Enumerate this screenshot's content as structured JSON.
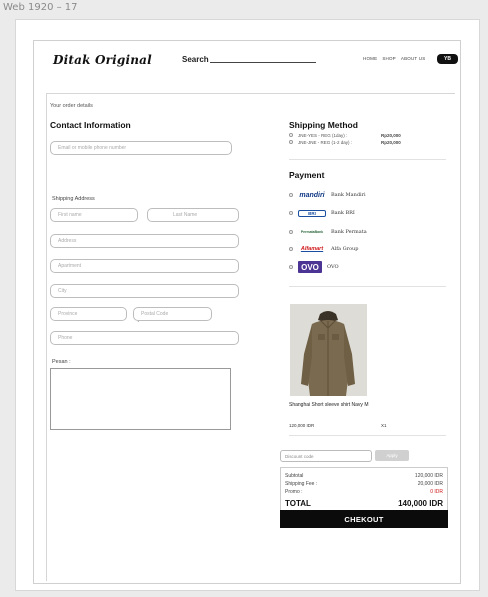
{
  "frame_title": "Web 1920 – 17",
  "navbar": {
    "logo": "Ditak Original",
    "search_label": "Search",
    "links": [
      "HOME",
      "SHOP",
      "ABOUT US"
    ],
    "cart_label": "YB"
  },
  "left": {
    "your_order": "Your order details",
    "contact_heading": "Contact Information",
    "email_placeholder": "Email or mobile phone number",
    "shipping_label": "Shipping Address",
    "first_name": "First name",
    "last_name": "Last Name",
    "address": "Address",
    "apartment": "Apartment",
    "city": "City",
    "province": "Province",
    "postal": "Postal Code",
    "phone": "Phone",
    "pesan_label": "Pesan :"
  },
  "right": {
    "shipping_heading": "Shipping Method",
    "shipping_options": [
      {
        "name": "JNE-YES - REG (1day)  :",
        "price": "Rp20,000"
      },
      {
        "name": "JNE-JNE - REG (1-2 day) :",
        "price": "Rp20,000"
      }
    ],
    "payment_heading": "Payment",
    "payments": [
      {
        "logo": "mandiri",
        "name": "Bank Mandiri",
        "icon": "mandiri-logo-icon"
      },
      {
        "logo": "BRI",
        "name": "Bank BRI",
        "icon": "bri-logo-icon"
      },
      {
        "logo": "PermataBank",
        "name": "Bank Permata",
        "icon": "permata-logo-icon"
      },
      {
        "logo": "Alfamart",
        "name": "Alfa Group",
        "icon": "alfamart-logo-icon"
      },
      {
        "logo": "OVO",
        "name": "OVO",
        "icon": "ovo-logo-icon"
      }
    ],
    "product": {
      "name": "Shanghai Short sleeve shirt Navy M",
      "price": "120,000 IDR",
      "qty": "X1"
    },
    "discount_placeholder": "Discount code",
    "apply_label": "Apply",
    "summary": {
      "subtotal_label": "Subtotal",
      "subtotal_value": "120,000 IDR",
      "shipping_label": "Shipping Fee :",
      "shipping_value": "20,000 IDR",
      "promo_label": "Promo :",
      "promo_value": "0 IDR",
      "total_label": "TOTAL",
      "total_value": "140,000 IDR"
    },
    "checkout_label": "CHEKOUT"
  },
  "colors": {
    "accent": "#0b0b0b",
    "promo": "#d01818",
    "ovo": "#4c3494"
  }
}
